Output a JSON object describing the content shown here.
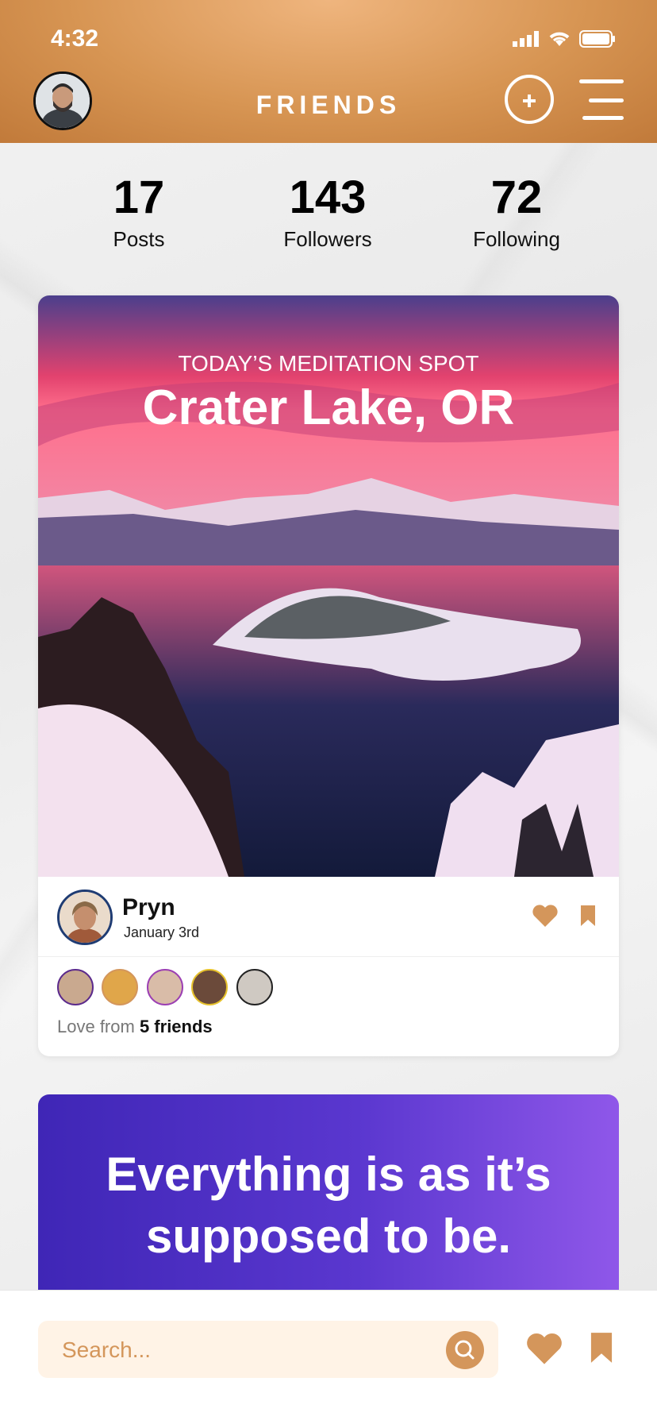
{
  "status_bar": {
    "time": "4:32"
  },
  "header": {
    "title": "FRIENDS"
  },
  "stats": [
    {
      "value": "17",
      "label": "Posts"
    },
    {
      "value": "143",
      "label": "Followers"
    },
    {
      "value": "72",
      "label": "Following"
    }
  ],
  "post": {
    "kicker": "TODAY’S MEDITATION SPOT",
    "title": "Crater Lake, OR",
    "author": "Pryn",
    "date": "January 3rd",
    "love_prefix": "Love from",
    "love_count": "5 friends"
  },
  "quote": {
    "line1": "Everything is as it’s",
    "line2": "supposed to be."
  },
  "search": {
    "placeholder": "Search..."
  },
  "colors": {
    "accent": "#d4965b",
    "quote_start": "#3f26b6",
    "quote_end": "#8f57e9"
  }
}
